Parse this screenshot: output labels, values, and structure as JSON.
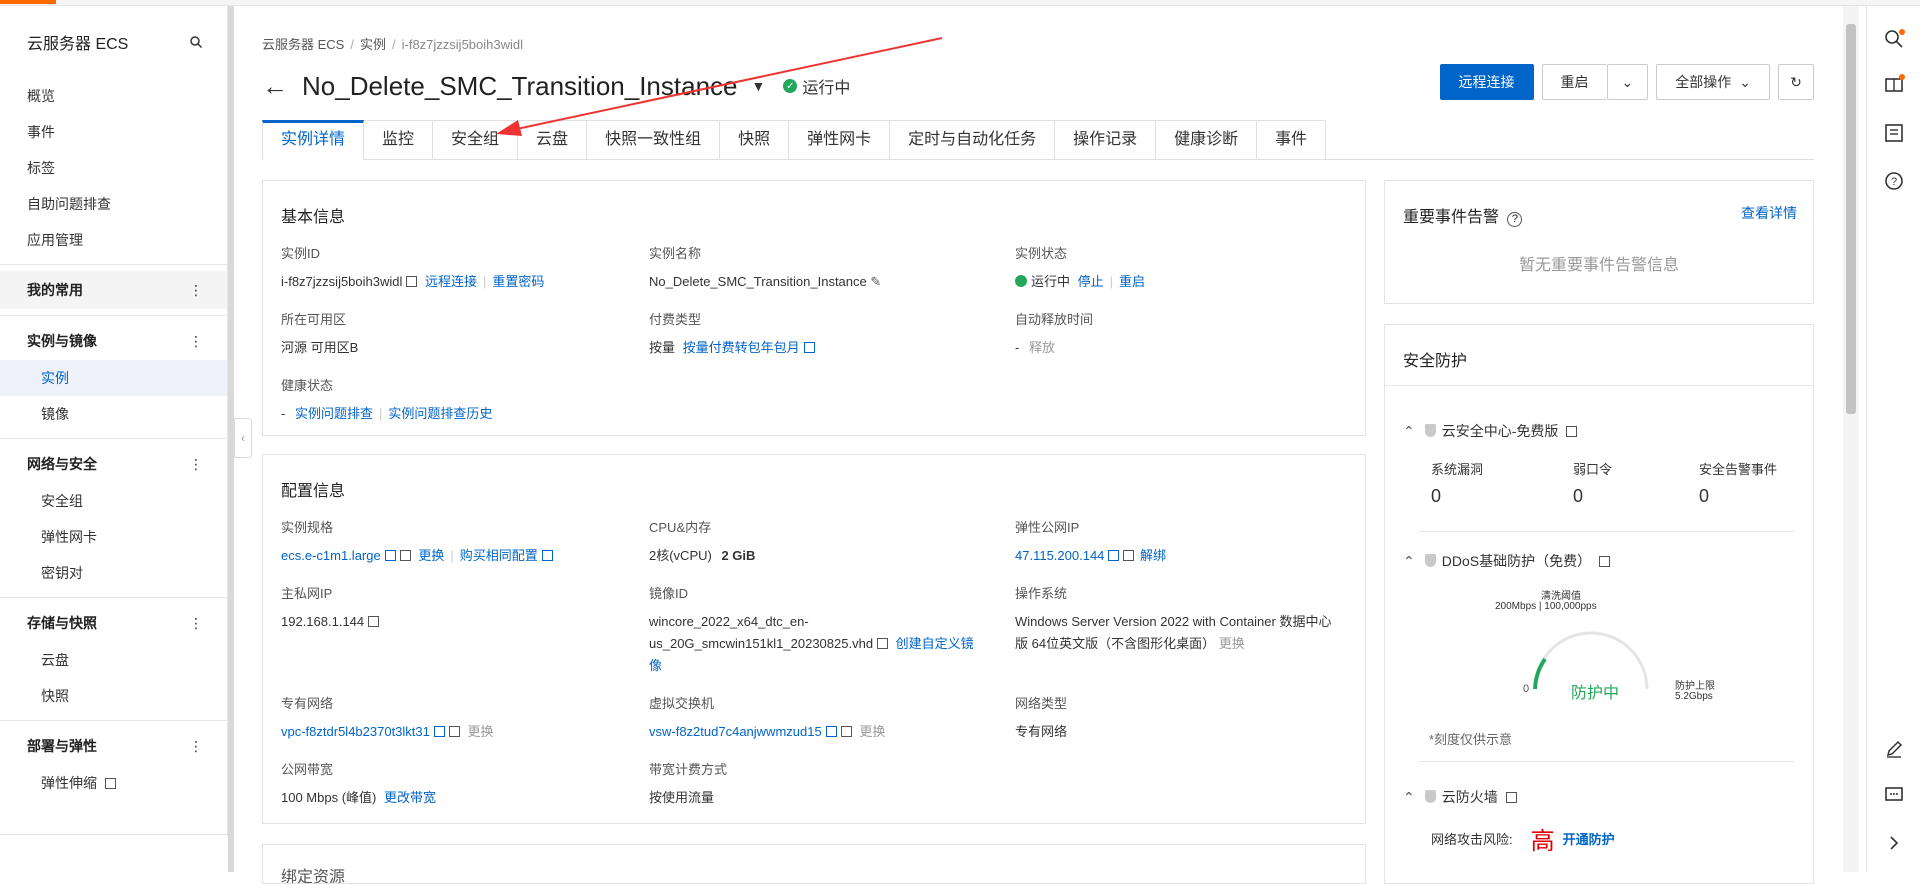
{
  "sidebar": {
    "title": "云服务器 ECS",
    "items": {
      "overview": "概览",
      "events": "事件",
      "tags": "标签",
      "self_troubleshoot": "自助问题排查",
      "app_management": "应用管理"
    },
    "groups": {
      "favorites": "我的常用",
      "instances_images": "实例与镜像",
      "network_security": "网络与安全",
      "storage_snapshots": "存储与快照",
      "deploy_elastic": "部署与弹性"
    },
    "sub": {
      "instance": "实例",
      "image": "镜像",
      "security_group": "安全组",
      "eni": "弹性网卡",
      "keypair": "密钥对",
      "disk": "云盘",
      "snapshot": "快照",
      "auto_scaling": "弹性伸缩"
    },
    "dots": "⋮"
  },
  "breadcrumb": {
    "root": "云服务器 ECS",
    "section": "实例",
    "current": "i-f8z7jzzsij5boih3widl",
    "sep": "/"
  },
  "header": {
    "back": "←",
    "title": "No_Delete_SMC_Transition_Instance",
    "caret": "▼",
    "status": "运行中",
    "btn_remote": "远程连接",
    "btn_restart": "重启",
    "btn_all_ops": "全部操作",
    "chevron": "⌄",
    "refresh": "↻"
  },
  "tabs": [
    "实例详情",
    "监控",
    "安全组",
    "云盘",
    "快照一致性组",
    "快照",
    "弹性网卡",
    "定时与自动化任务",
    "操作记录",
    "健康诊断",
    "事件"
  ],
  "basic": {
    "title": "基本信息",
    "id_label": "实例ID",
    "id_value": "i-f8z7jzzsij5boih3widl",
    "remote_link": "远程连接",
    "reset_pwd": "重置密码",
    "name_label": "实例名称",
    "name_value": "No_Delete_SMC_Transition_Instance",
    "state_label": "实例状态",
    "state_value": "运行中",
    "stop": "停止",
    "restart": "重启",
    "zone_label": "所在可用区",
    "zone_value": "河源 可用区B",
    "pay_label": "付费类型",
    "pay_value": "按量",
    "pay_link": "按量付费转包年包月",
    "release_label": "自动释放时间",
    "release_dash": "-",
    "release_link": "释放",
    "health_label": "健康状态",
    "health_dash": "-",
    "health_link1": "实例问题排查",
    "health_link2": "实例问题排查历史"
  },
  "config": {
    "title": "配置信息",
    "spec_label": "实例规格",
    "spec_value": "ecs.e-c1m1.large",
    "change": "更换",
    "buy_same": "购买相同配置",
    "cpu_label": "CPU&内存",
    "cpu_value": "2核(vCPU)",
    "mem_value": "2 GiB",
    "eip_label": "弹性公网IP",
    "eip_value": "47.115.200.144",
    "unbind": "解绑",
    "ip_label": "主私网IP",
    "ip_value": "192.168.1.144",
    "image_label": "镜像ID",
    "image_value_1": "wincore_2022_x64_dtc_en-",
    "image_value_2": "us_20G_smcwin151kl1_20230825.vhd",
    "create_image_1": "创建自定义镜",
    "create_image_2": "像",
    "os_label": "操作系统",
    "os_value_1": "Windows Server Version 2022 with Container 数据中心",
    "os_value_2": "版 64位英文版（不含图形化桌面）",
    "os_change": "更换",
    "vpc_label": "专有网络",
    "vpc_value": "vpc-f8ztdr5l4b2370t3lkt31",
    "vpc_change": "更换",
    "vsw_label": "虚拟交换机",
    "vsw_value": "vsw-f8z2tud7c4anjwwmzud15",
    "vsw_change": "更换",
    "net_type_label": "网络类型",
    "net_type_value": "专有网络",
    "bw_label": "公网带宽",
    "bw_value": "100 Mbps (峰值)",
    "bw_link": "更改带宽",
    "bw_billing_label": "带宽计费方式",
    "bw_billing_value": "按使用流量",
    "next_title": "绑定资源"
  },
  "events_panel": {
    "title": "重要事件告警",
    "help": "?",
    "detail_link": "查看详情",
    "empty": "暂无重要事件告警信息"
  },
  "security": {
    "title": "安全防护",
    "center_title": "云安全中心-免费版",
    "vuln_label": "系统漏洞",
    "vuln_value": "0",
    "weak_label": "弱口令",
    "weak_value": "0",
    "alert_label": "安全告警事件",
    "alert_value": "0",
    "ddos_title": "DDoS基础防护（免费）",
    "threshold_label": "清洗阈值",
    "threshold_value": "200Mbps | 100,000pps",
    "gauge_zero": "0",
    "gauge_status": "防护中",
    "limit_label": "防护上限",
    "limit_value": "5.2Gbps",
    "scale_note": "*刻度仅供示意",
    "firewall_title": "云防火墙",
    "risk_label": "网络攻击风险:",
    "risk_level": "高",
    "enable_link": "开通防护"
  },
  "colors": {
    "accent": "#0064c8",
    "success": "#23a85b",
    "danger": "#e00000",
    "brand": "#ff6a00"
  }
}
